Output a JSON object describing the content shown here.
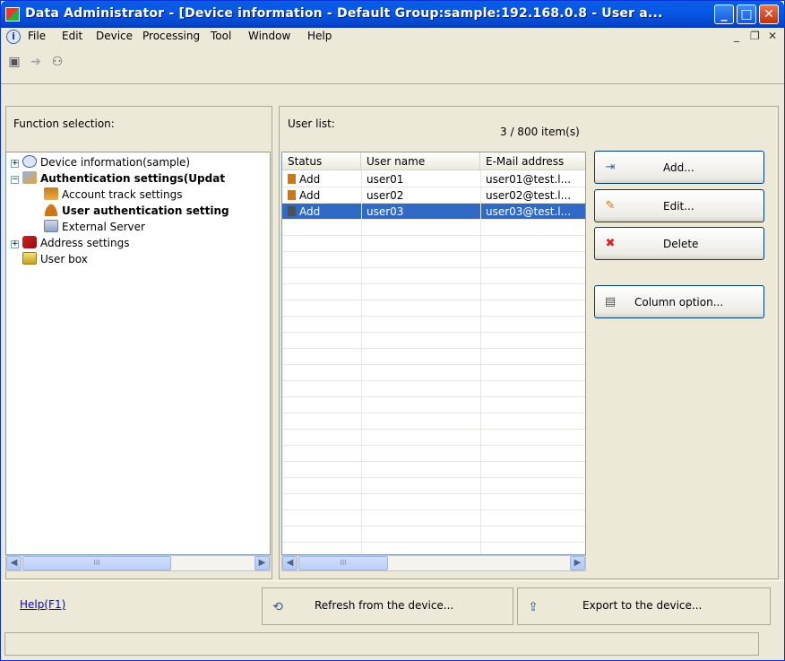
{
  "window": {
    "title": "Data Administrator - [Device information - Default Group:sample:192.168.0.8 - User a...",
    "minimize": "_",
    "maximize": "□",
    "close": "✕"
  },
  "menu": {
    "items": [
      "File",
      "Edit",
      "Device",
      "Processing",
      "Tool",
      "Window",
      "Help"
    ],
    "mdi": {
      "minimize": "_",
      "restore": "❐",
      "close": "✕"
    }
  },
  "toolbar": {
    "icons": [
      "device-icon",
      "arrow-disabled-icon",
      "users-icon"
    ]
  },
  "left_pane": {
    "label": "Function selection:",
    "tree": [
      {
        "label": "Device information(sample)",
        "bold": false,
        "expander": "+"
      },
      {
        "label": "Authentication settings(Updat",
        "bold": true,
        "expander": "−"
      },
      {
        "label": "Account track settings",
        "bold": false
      },
      {
        "label": "User authentication setting",
        "bold": true
      },
      {
        "label": "External Server",
        "bold": false
      },
      {
        "label": "Address settings",
        "bold": false,
        "expander": "+"
      },
      {
        "label": "User box",
        "bold": false
      }
    ],
    "scroll_thumb_label": "III"
  },
  "right_pane": {
    "label": "User list:",
    "count": "3 / 800 item(s)",
    "columns": [
      "Status",
      "User name",
      "E-Mail address"
    ],
    "rows": [
      {
        "status": "Add",
        "user": "user01",
        "email": "user01@test.l..."
      },
      {
        "status": "Add",
        "user": "user02",
        "email": "user02@test.l..."
      },
      {
        "status": "Add",
        "user": "user03",
        "email": "user03@test.l..."
      }
    ],
    "selected_row": 2,
    "scroll_thumb_label": "III"
  },
  "actions": {
    "add": "Add...",
    "edit": "Edit...",
    "delete": "Delete",
    "column_option": "Column option..."
  },
  "bottom": {
    "help": "Help(F1)",
    "refresh": "Refresh from the device...",
    "export": "Export to the device..."
  },
  "colors": {
    "title_bar": "#0757e8",
    "selection": "#316ac5",
    "window_bg": "#ece9d8"
  }
}
